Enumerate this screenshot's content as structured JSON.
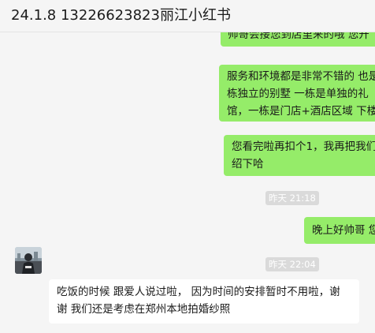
{
  "window": {
    "title": "24.1.8 13226623823丽江小红书"
  },
  "messages": {
    "m0": {
      "line1": "帅哥会接您到店里来的哦 您开"
    },
    "m1": {
      "line1": "服务和环境都是非常不错的 也是",
      "line2": "栋独立的别墅 一栋是单独的礼",
      "line3": "馆，一栋是门店+酒店区域 下楼"
    },
    "m2": {
      "line1": "您看完啦再扣个1，我再把我们",
      "line2": "绍下哈"
    },
    "t1": "昨天 21:18",
    "m3": {
      "line1": "晚上好帅哥 您"
    },
    "t2": "昨天 22:04",
    "m4": {
      "line1": "吃饭的时候 跟爱人说过啦， 因为时间的安排暂时不用啦，谢",
      "line2": "谢 我们还是考虑在郑州本地拍婚纱照"
    }
  },
  "colors": {
    "outgoing_bubble": "#95ec69",
    "incoming_bubble": "#ffffff",
    "background": "#f5f5f5",
    "timestamp_bg": "#dadada"
  }
}
